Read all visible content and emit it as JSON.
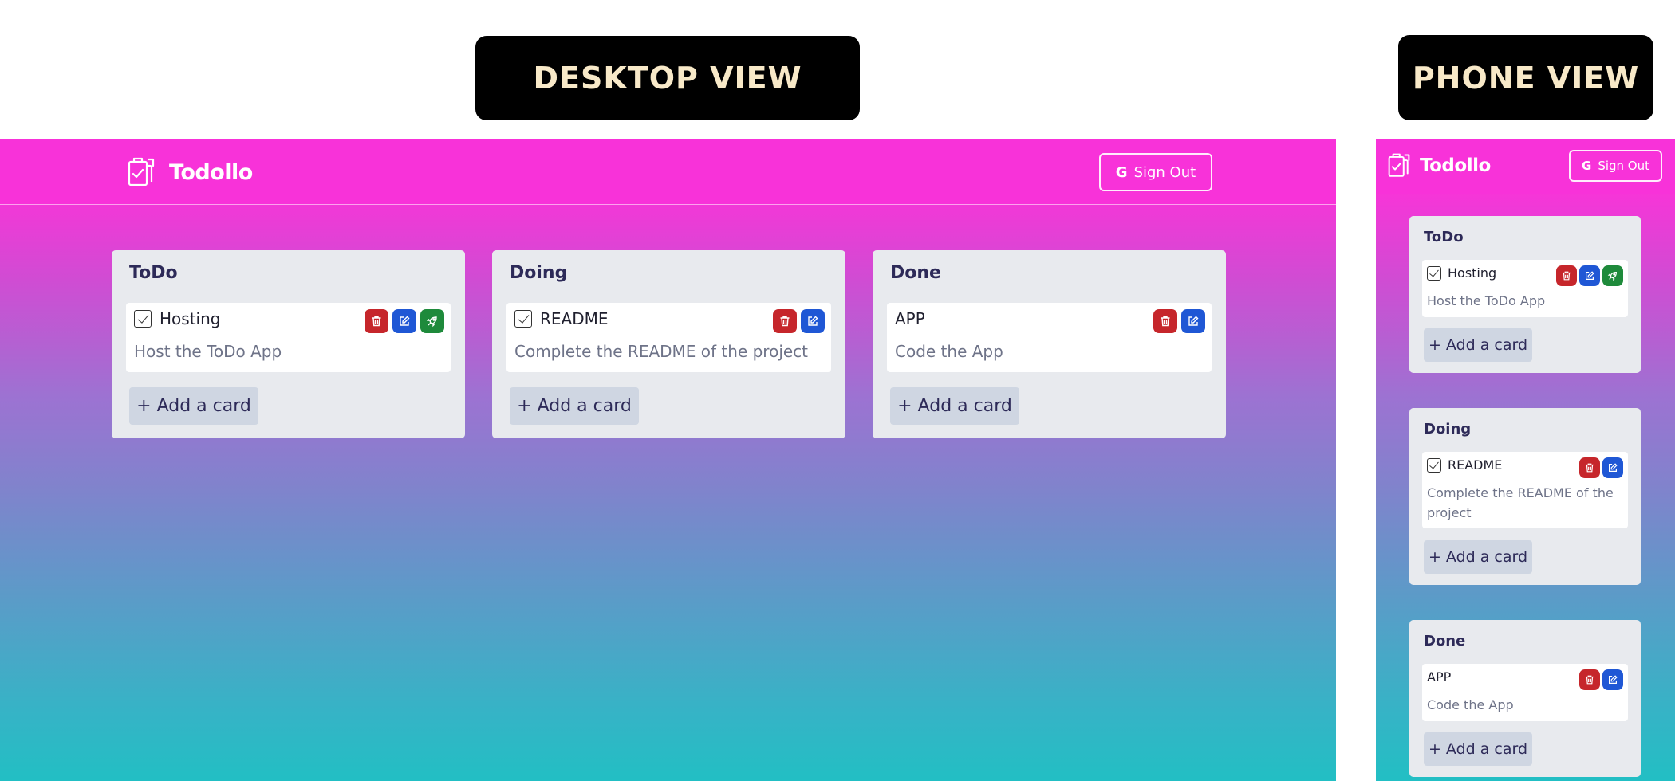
{
  "labels": {
    "desktop": "DESKTOP VIEW",
    "phone": "PHONE VIEW"
  },
  "app": {
    "brand": "Todollo",
    "signout_label": "Sign Out",
    "add_card_label": "+ Add a card"
  },
  "colors": {
    "header": "#f832d9",
    "gradient_top": "#f931d9",
    "gradient_bottom": "#22bfc4",
    "delete": "#c6262b",
    "edit": "#1f57d5",
    "launch": "#1e8a3b"
  },
  "lists": [
    {
      "title": "ToDo",
      "cards": [
        {
          "title": "Hosting",
          "description": "Host the ToDo App",
          "checked": true,
          "actions": [
            "delete-icon",
            "edit-icon",
            "rocket-icon"
          ]
        }
      ]
    },
    {
      "title": "Doing",
      "cards": [
        {
          "title": "README",
          "description": "Complete the README of the project",
          "checked": true,
          "actions": [
            "delete-icon",
            "edit-icon"
          ]
        }
      ]
    },
    {
      "title": "Done",
      "cards": [
        {
          "title": "APP",
          "description": "Code the App",
          "checked": false,
          "actions": [
            "delete-icon",
            "edit-icon"
          ]
        }
      ]
    }
  ]
}
